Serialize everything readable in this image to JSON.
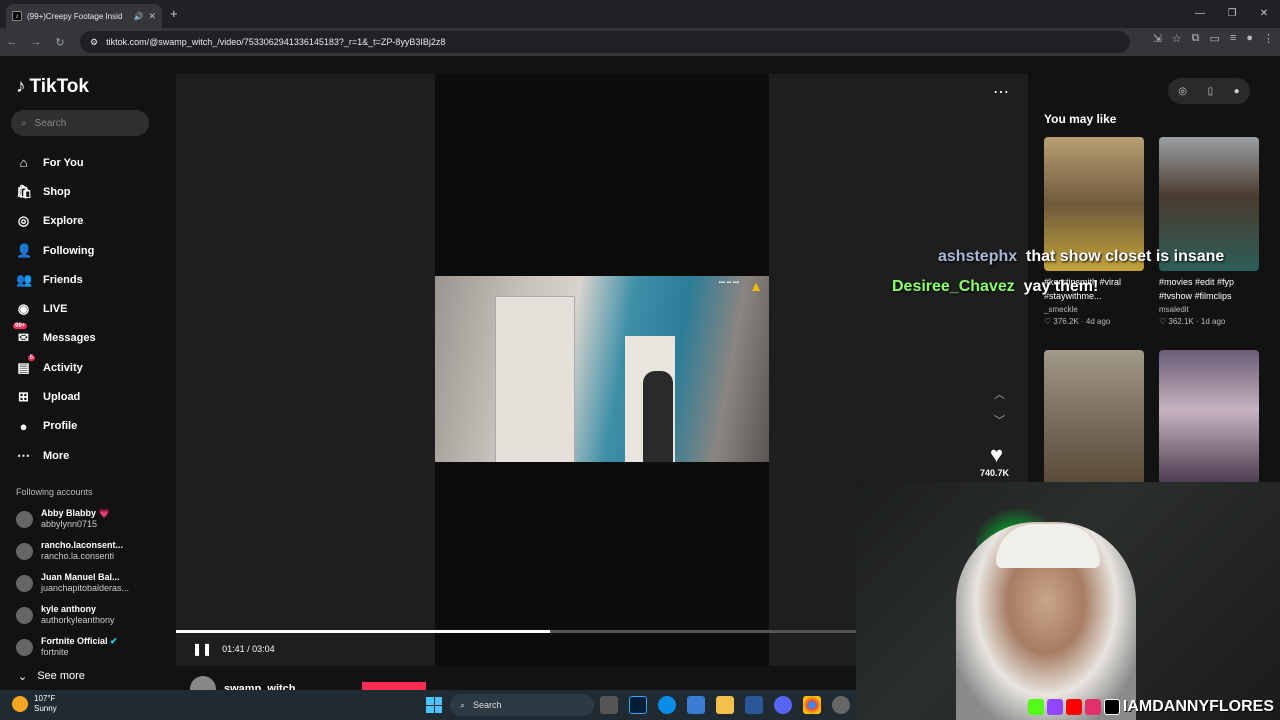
{
  "browser": {
    "tab_title": "(99+)Creepy Footage Insid",
    "url": "tiktok.com/@swamp_witch_/video/7533062941336145183?_r=1&_t=ZP-8yyB3IBj2z8"
  },
  "tiktok": {
    "logo": "TikTok",
    "search_placeholder": "Search",
    "nav": [
      {
        "label": "For You",
        "icon": "home-icon"
      },
      {
        "label": "Shop",
        "icon": "shop-icon"
      },
      {
        "label": "Explore",
        "icon": "explore-icon"
      },
      {
        "label": "Following",
        "icon": "following-icon"
      },
      {
        "label": "Friends",
        "icon": "friends-icon"
      },
      {
        "label": "LIVE",
        "icon": "live-icon"
      },
      {
        "label": "Messages",
        "icon": "messages-icon",
        "badge": "99+"
      },
      {
        "label": "Activity",
        "icon": "activity-icon",
        "badge": "5"
      },
      {
        "label": "Upload",
        "icon": "upload-icon"
      },
      {
        "label": "Profile",
        "icon": "profile-icon"
      },
      {
        "label": "More",
        "icon": "more-icon"
      }
    ],
    "following_header": "Following accounts",
    "following": [
      {
        "name": "Abby Blabby 💗",
        "handle": "abbylynn0715"
      },
      {
        "name": "rancho.laconsent...",
        "handle": "rancho.la.consenti"
      },
      {
        "name": "Juan Manuel Bal...",
        "handle": "juanchapitobalderas..."
      },
      {
        "name": "kyle anthony",
        "handle": "authorkyleanthony"
      },
      {
        "name": "Fortnite Official",
        "handle": "fortnite"
      }
    ],
    "see_more": "See more",
    "player": {
      "time": "01:41 / 03:04",
      "progress": 0.55,
      "likes": "740.7K",
      "author": "swamp_witch_"
    },
    "you_may_like": "You may like",
    "suggestions": [
      {
        "title": "#kerstinsmith #viral #staywithme...",
        "user": "_smeckle",
        "likes": "376.2K",
        "age": "4d ago",
        "color": "#c9a437"
      },
      {
        "title": "#movies #edit #fyp #tvshow #filmclips",
        "user": "msaledit",
        "likes": "362.1K",
        "age": "1d ago",
        "color": "#5f6b6a"
      },
      {
        "title": "",
        "user": "",
        "likes": "",
        "age": "",
        "color": "#8b7f68"
      },
      {
        "title": "",
        "user": "",
        "likes": "",
        "age": "",
        "color": "#6a5a70"
      }
    ]
  },
  "chat": [
    {
      "user": "ashstephx",
      "message": "that show closet is insane",
      "user_color": "#aab8d8"
    },
    {
      "user": "Desiree_Chavez",
      "message": "yay them!",
      "user_color": "#8dff6b"
    }
  ],
  "stream": {
    "brand": "IAMDANNYFLORES"
  },
  "taskbar": {
    "temp": "107°F",
    "condition": "Sunny",
    "search": "Search"
  }
}
